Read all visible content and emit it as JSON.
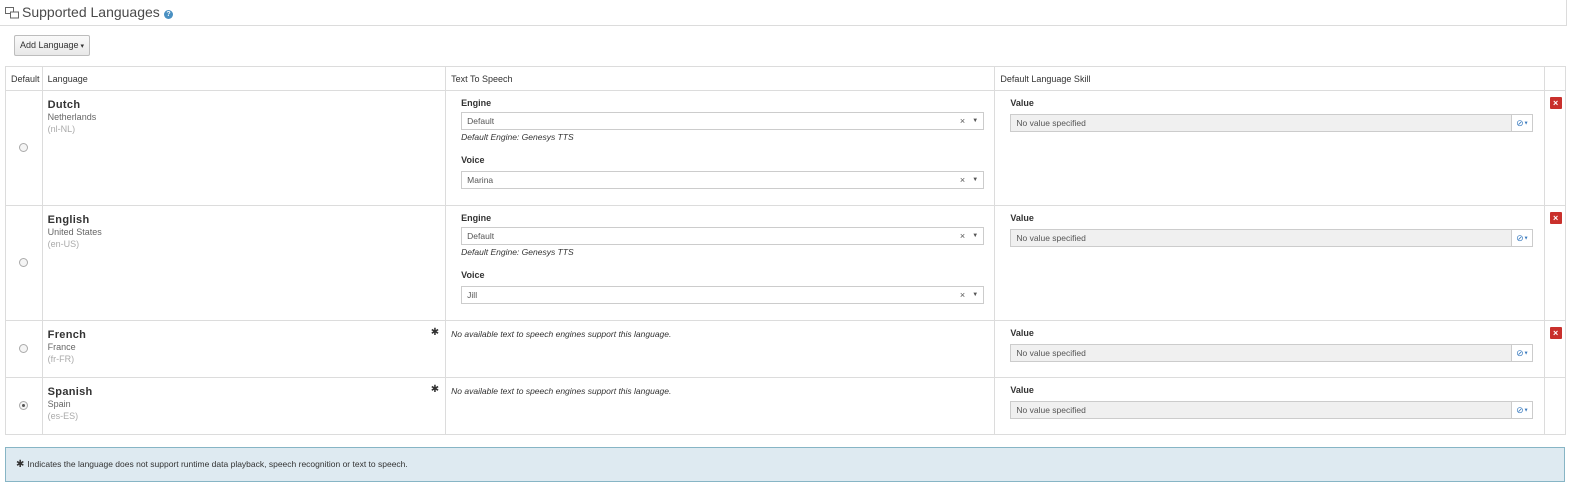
{
  "header": {
    "title": "Supported Languages",
    "help_glyph": "?"
  },
  "toolbar": {
    "add_language_label": "Add Language",
    "add_language_caret": "▾"
  },
  "table": {
    "columns": {
      "default": "Default",
      "language": "Language",
      "tts": "Text To Speech",
      "skill": "Default Language Skill"
    },
    "labels": {
      "engine": "Engine",
      "voice": "Voice",
      "value": "Value",
      "default_engine_hint": "Default Engine: Genesys TTS",
      "no_tts": "No available text to speech engines support this language.",
      "skill_placeholder": "No value specified",
      "clear": "×",
      "arrow": "▼",
      "delete": "×",
      "star": "✱"
    },
    "rows": [
      {
        "name": "Dutch",
        "country": "Netherlands",
        "code": "(nl-NL)",
        "engine": "Default",
        "voice": "Marina",
        "selected": false
      },
      {
        "name": "English",
        "country": "United States",
        "code": "(en-US)",
        "engine": "Default",
        "voice": "Jill",
        "selected": false
      },
      {
        "name": "French",
        "country": "France",
        "code": "(fr-FR)",
        "selected": false
      },
      {
        "name": "Spanish",
        "country": "Spain",
        "code": "(es-ES)",
        "selected": true
      }
    ]
  },
  "note": {
    "star": "✱",
    "text": "Indicates the language does not support runtime data playback, speech recognition or text to speech."
  },
  "icons": {
    "header": "language-icon",
    "help": "help-icon",
    "delete": "delete-icon",
    "skill_picker": "no-value-icon"
  },
  "colors": {
    "delete": "#c9302c",
    "note_bg": "#deeaf1",
    "note_border": "#87b5c5",
    "link": "#3a7bbf"
  }
}
